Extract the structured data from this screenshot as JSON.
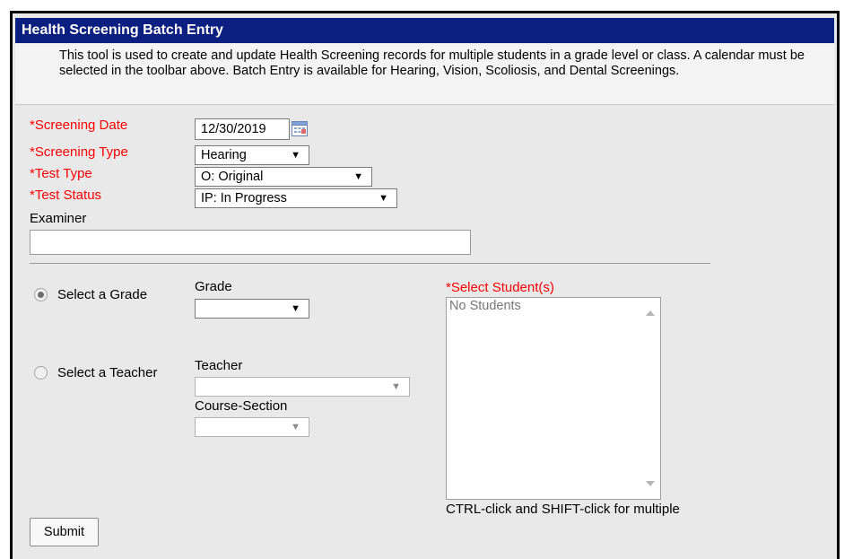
{
  "title": "Health Screening Batch Entry",
  "intro": "This tool is used to create and update Health Screening records for multiple students in a grade level or class. A calendar must be selected in the toolbar above. Batch Entry is available for Hearing, Vision, Scoliosis, and Dental Screenings.",
  "fields": {
    "screening_date": {
      "label": "*Screening Date",
      "value": "12/30/2019"
    },
    "screening_type": {
      "label": "*Screening Type",
      "value": "Hearing"
    },
    "test_type": {
      "label": "*Test Type",
      "value": "O: Original"
    },
    "test_status": {
      "label": "*Test Status",
      "value": "IP: In Progress"
    },
    "examiner": {
      "label": "Examiner",
      "value": ""
    }
  },
  "selection": {
    "grade_radio_label": "Select a Grade",
    "grade_radio_checked": true,
    "grade_label": "Grade",
    "grade_value": "",
    "teacher_radio_label": "Select a Teacher",
    "teacher_label": "Teacher",
    "teacher_value": "",
    "course_section_label": "Course-Section",
    "course_section_value": ""
  },
  "students": {
    "label": "*Select Student(s)",
    "items": [
      "No Students"
    ],
    "hint": "CTRL-click and SHIFT-click for multiple"
  },
  "submit_label": "Submit",
  "colors": {
    "title_bar": "#0a1f80",
    "required_label": "#ff0000",
    "panel_bg": "#e9e9e9"
  },
  "icons": {
    "calendar": "calendar-icon",
    "dropdown": "chevron-down-icon"
  }
}
